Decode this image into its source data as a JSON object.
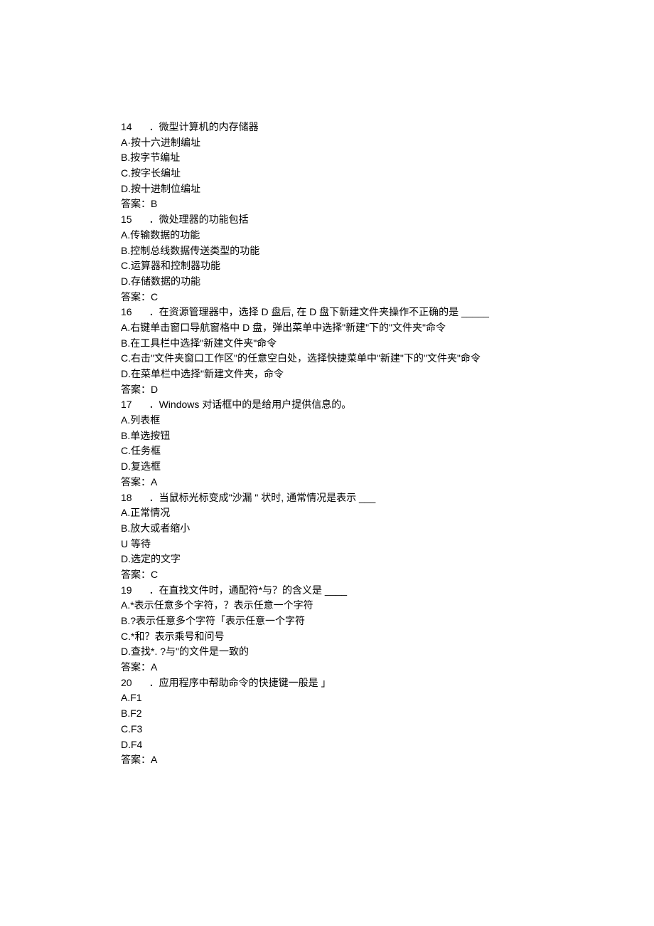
{
  "questions": [
    {
      "num": "14",
      "stem": "．微型计算机的内存储器",
      "options": [
        "A·按十六进制编址",
        "B.按字节编址",
        "C.按字长编址",
        "D.按十进制位编址"
      ],
      "answer": "答案：B"
    },
    {
      "num": "15",
      "stem": "．微处理器的功能包括",
      "options": [
        "A.传输数据的功能",
        "B.控制总线数据传送类型的功能",
        "C.运算器和控制器功能",
        "D.存储数据的功能"
      ],
      "answer": "答案：C"
    },
    {
      "num": "16",
      "stem": "．在资源管理器中，选择 D 盘后, 在 D 盘下新建文件夹操作不正确的是 _____",
      "options": [
        "A.右键单击窗口导航窗格中 D 盘，弹出菜单中选择\"新建\"下的\"文件夹\"命令",
        "B.在工具栏中选择\"新建文件夹\"命令",
        "C.右击\"文件夹窗口工作区\"的任意空白处，选择快捷菜单中\"新建\"下的\"文件夹\"命令",
        "D.在菜单栏中选择\"新建文件夹，命令"
      ],
      "answer": "答案：D"
    },
    {
      "num": "17",
      "stem": "．Windows 对话框中的是给用户提供信息的。",
      "options": [
        "A.列表框",
        "B.单选按钮",
        "C.任务框",
        "D.复选框"
      ],
      "answer": "答案：A"
    },
    {
      "num": "18",
      "stem": "．当鼠标光标变成\"沙漏 \" 状时, 通常情况是表示 ___",
      "options": [
        "A.正常情况",
        "B.放大或者缩小",
        "U 等待",
        "D.选定的文字"
      ],
      "answer": "答案：C"
    },
    {
      "num": "19",
      "stem": "．在直找文件时，通配符*与？的含义是 ____",
      "options": [
        "A.*表示任意多个字符，？表示任意一个字符",
        "B.?表示任意多个字符「表示任意一个字符",
        "C.*和？表示乘号和问号",
        "D.查找*. ?与\"的文件是一致的"
      ],
      "answer": "答案：A"
    },
    {
      "num": "20",
      "stem": "．应用程序中帮助命令的快捷键一般是 」",
      "options": [
        "A.F1",
        "B.F2",
        "C.F3",
        "D.F4"
      ],
      "answer": "答案：A"
    }
  ]
}
